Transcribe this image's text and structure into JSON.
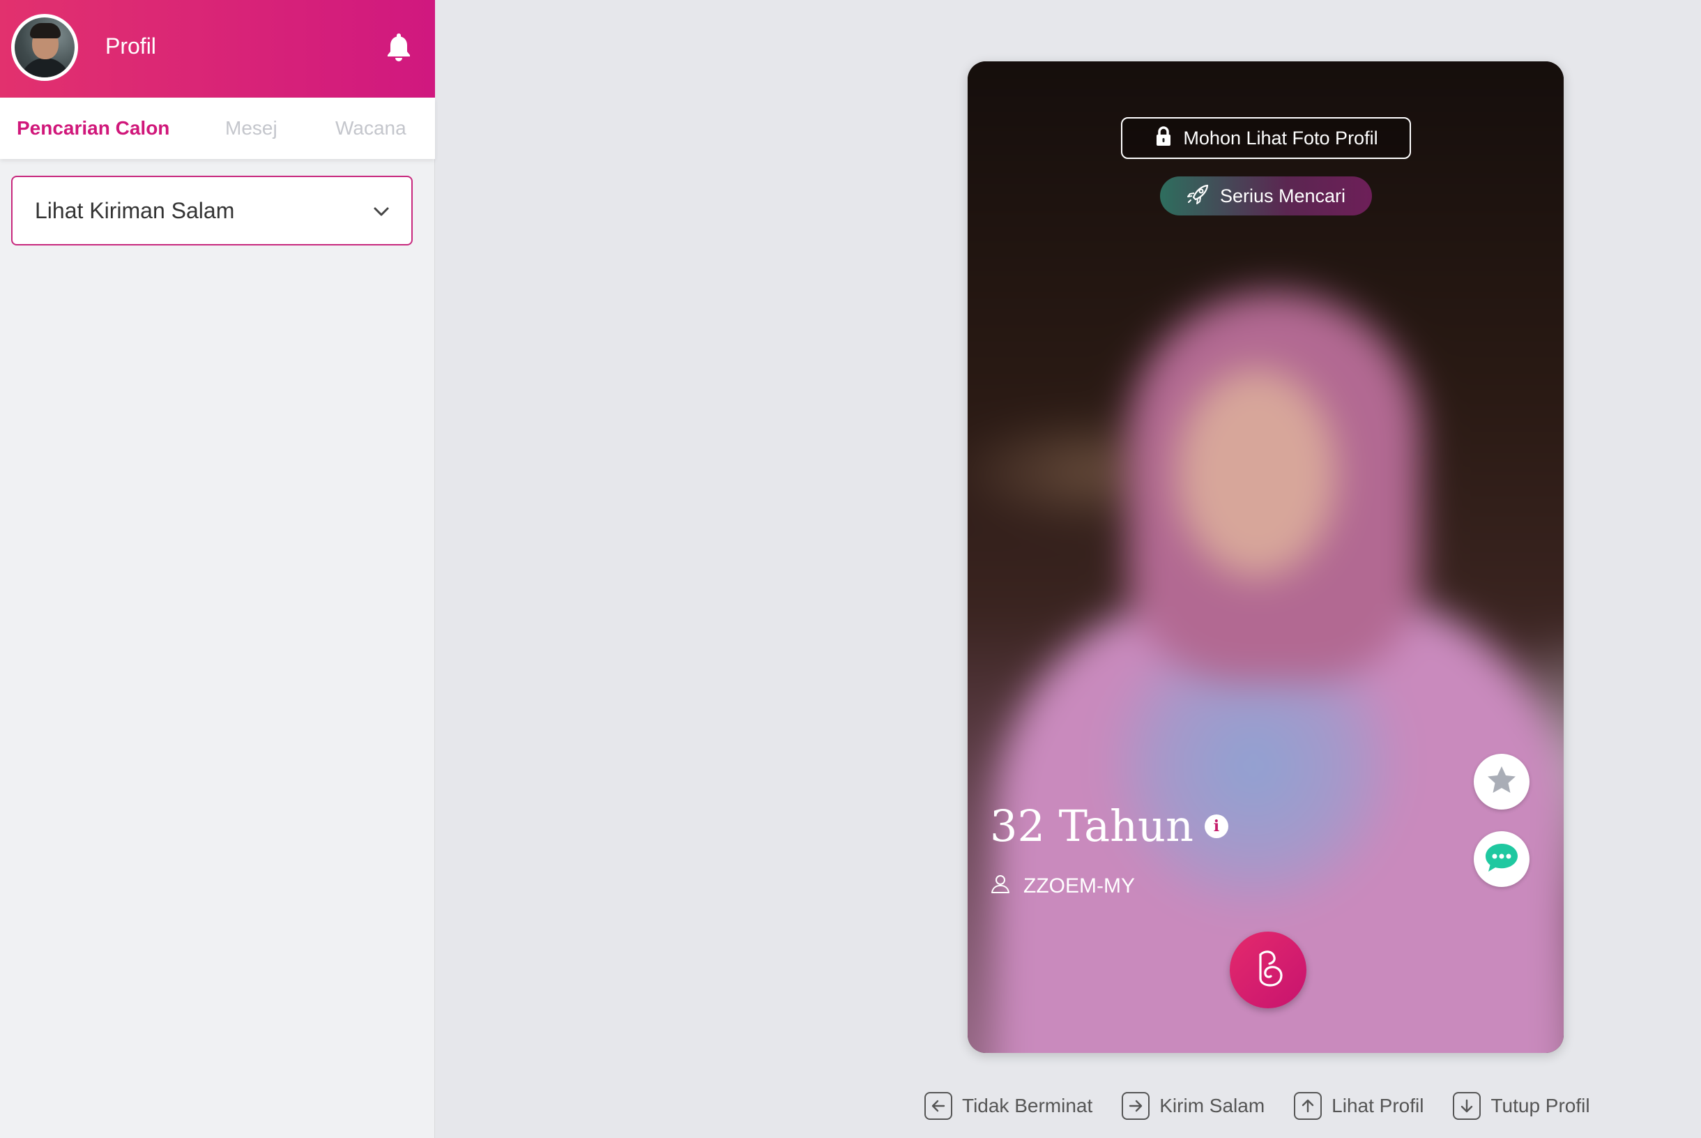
{
  "header": {
    "profile_label": "Profil",
    "avatar_icon": "user-avatar",
    "bell_icon": "bell-icon"
  },
  "tabs": [
    {
      "label": "Pencarian Calon",
      "active": true
    },
    {
      "label": "Mesej",
      "active": false
    },
    {
      "label": "Wacana",
      "active": false
    }
  ],
  "dropdown": {
    "selected": "Lihat Kiriman Salam"
  },
  "card": {
    "request_photo_label": "Mohon Lihat Foto Profil",
    "status_badge": "Serius Mencari",
    "age": "32 Tahun",
    "user_id": "ZZOEM-MY"
  },
  "hints": [
    {
      "key_icon": "arrow-left-icon",
      "label": "Tidak Berminat"
    },
    {
      "key_icon": "arrow-right-icon",
      "label": "Kirim Salam"
    },
    {
      "key_icon": "arrow-up-icon",
      "label": "Lihat Profil"
    },
    {
      "key_icon": "arrow-down-icon",
      "label": "Tutup Profil"
    }
  ],
  "colors": {
    "brand": "#d0177a",
    "header_gradient_start": "#e2316e",
    "header_gradient_end": "#d0187f",
    "chat_green": "#1fc8a0",
    "star_gray": "#a9adb6"
  }
}
